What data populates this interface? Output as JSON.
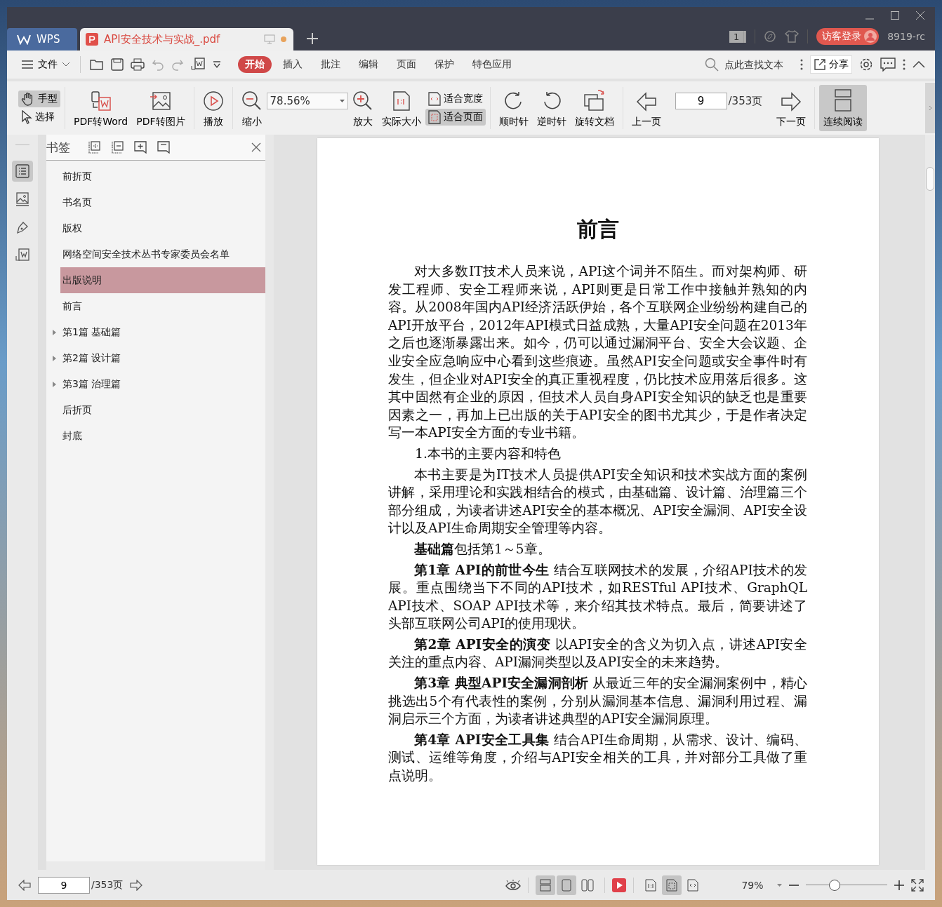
{
  "window": {
    "tabs": [
      {
        "label": "WPS",
        "kind": "home",
        "selected": false
      },
      {
        "label": "API安全技术与实战_.pdf",
        "kind": "document",
        "selected": true
      }
    ],
    "unread_count": "1",
    "login_button": "访客登录",
    "user_id": "8919-rc"
  },
  "menu": {
    "file": "文件",
    "tabs": [
      {
        "label": "开始",
        "selected": true
      },
      {
        "label": "插入",
        "selected": false
      },
      {
        "label": "批注",
        "selected": false
      },
      {
        "label": "编辑",
        "selected": false
      },
      {
        "label": "页面",
        "selected": false
      },
      {
        "label": "保护",
        "selected": false
      },
      {
        "label": "特色应用",
        "selected": false
      }
    ],
    "search_placeholder": "点此查找文本",
    "share": "分享"
  },
  "toolbar": {
    "hand": {
      "label": "手型",
      "selected": true
    },
    "select": {
      "label": "选择",
      "selected": false
    },
    "pdf_to_word": "PDF转Word",
    "pdf_to_image": "PDF转图片",
    "play": "播放",
    "zoom_out": "缩小",
    "zoom_value": "78.56%",
    "zoom_in": "放大",
    "actual_size": "实际大小",
    "fit_width": {
      "label": "适合宽度",
      "selected": false
    },
    "fit_page": {
      "label": "适合页面",
      "selected": true
    },
    "clockwise": "顺时针",
    "counterclockwise": "逆时针",
    "rotate": "旋转文档",
    "prev_page": "上一页",
    "page": "9",
    "page_total": "/353页",
    "next_page": "下一页",
    "continuous": {
      "label": "连续阅读",
      "selected": true
    }
  },
  "side_strip": [
    {
      "selected": true
    },
    {
      "selected": false
    },
    {
      "selected": false
    },
    {
      "selected": false
    }
  ],
  "bookmarks": {
    "title": "书签",
    "items": [
      {
        "label": "前折页",
        "expandable": false,
        "selected": false
      },
      {
        "label": "书名页",
        "expandable": false,
        "selected": false
      },
      {
        "label": "版权",
        "expandable": false,
        "selected": false
      },
      {
        "label": "网络空间安全技术丛书专家委员会名单",
        "expandable": false,
        "selected": false
      },
      {
        "label": "出版说明",
        "expandable": false,
        "selected": true
      },
      {
        "label": "前言",
        "expandable": false,
        "selected": false
      },
      {
        "label": "第1篇 基础篇",
        "expandable": true,
        "selected": false
      },
      {
        "label": "第2篇 设计篇",
        "expandable": true,
        "selected": false
      },
      {
        "label": "第3篇 治理篇",
        "expandable": true,
        "selected": false
      },
      {
        "label": "后折页",
        "expandable": false,
        "selected": false
      },
      {
        "label": "封底",
        "expandable": false,
        "selected": false
      }
    ]
  },
  "document": {
    "title": "前言",
    "paragraphs": [
      {
        "kind": "body",
        "text": "对大多数IT技术人员来说，API这个词并不陌生。而对架构师、研发工程师、安全工程师来说，API则更是日常工作中接触并熟知的内容。从2008年国内API经济活跃伊始，各个互联网企业纷纷构建自己的API开放平台，2012年API模式日益成熟，大量API安全问题在2013年之后也逐渐暴露出来。如今，仍可以通过漏洞平台、安全大会议题、企业安全应急响应中心看到这些痕迹。虽然API安全问题或安全事件时有发生，但企业对API安全的真正重视程度，仍比技术应用落后很多。这其中固然有企业的原因，但技术人员自身API安全知识的缺乏也是重要因素之一，再加上已出版的关于API安全的图书尤其少，于是作者决定写一本API安全方面的专业书籍。"
      },
      {
        "kind": "heading",
        "text": "1.本书的主要内容和特色"
      },
      {
        "kind": "body",
        "text": "本书主要是为IT技术人员提供API安全知识和技术实战方面的案例讲解，采用理论和实践相结合的模式，由基础篇、设计篇、治理篇三个部分组成，为读者讲述API安全的基本概况、API安全漏洞、API安全设计以及API生命周期安全管理等内容。"
      },
      {
        "kind": "body",
        "text": "**基础篇**包括第1～5章。"
      },
      {
        "kind": "body",
        "text": "**第1章 API的前世今生** 结合互联网技术的发展，介绍API技术的发展。重点围绕当下不同的API技术，如RESTful API技术、GraphQL API技术、SOAP API技术等，来介绍其技术特点。最后，简要讲述了头部互联网公司API的使用现状。"
      },
      {
        "kind": "body",
        "text": "**第2章 API安全的演变** 以API安全的含义为切入点，讲述API安全关注的重点内容、API漏洞类型以及API安全的未来趋势。"
      },
      {
        "kind": "body",
        "text": "**第3章 典型API安全漏洞剖析** 从最近三年的安全漏洞案例中，精心挑选出5个有代表性的案例，分别从漏洞基本信息、漏洞利用过程、漏洞启示三个方面，为读者讲述典型的API安全漏洞原理。"
      },
      {
        "kind": "body",
        "text": "**第4章 API安全工具集** 结合API生命周期，从需求、设计、编码、测试、运维等角度，介绍与API安全相关的工具，并对部分工具做了重点说明。"
      }
    ]
  },
  "status_bar": {
    "page": "9",
    "page_total": "/353页",
    "views": [
      {
        "selected": true
      },
      {
        "selected": true
      },
      {
        "selected": false
      }
    ],
    "fit_modes": [
      {
        "selected": false
      },
      {
        "selected": true
      },
      {
        "selected": false
      }
    ],
    "zoom": "79%",
    "zoom_slider": {
      "level": 0.35
    }
  }
}
